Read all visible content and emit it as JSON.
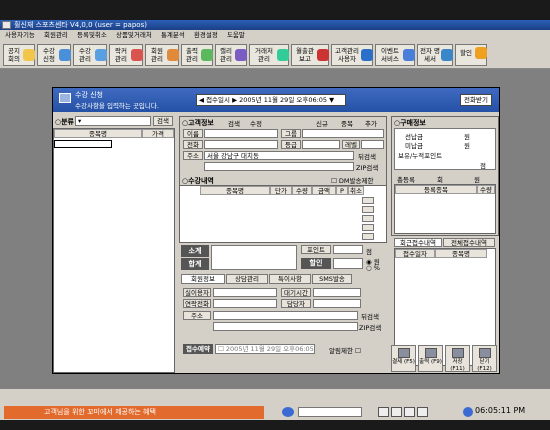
{
  "window": {
    "title": "휠신재 스포츠센타 V4,0,0 (user = papos)"
  },
  "menu": [
    "사용자기능",
    "회원관리",
    "등록및취소",
    "상품및거래처",
    "통계분석",
    "환경설정",
    "도움말"
  ],
  "toolbar": [
    {
      "label": "공지 회의",
      "icon": "note-icon",
      "color": "#f2c64a"
    },
    {
      "label": "수강 신청",
      "icon": "register-icon",
      "color": "#4a90d9"
    },
    {
      "label": "수강 관리",
      "icon": "manage-icon",
      "color": "#5aa0e0"
    },
    {
      "label": "락커 관리",
      "icon": "locker-icon",
      "color": "#d9534f"
    },
    {
      "label": "회원 관리",
      "icon": "members-icon",
      "color": "#e08a3c"
    },
    {
      "label": "출력 관리",
      "icon": "print-icon",
      "color": "#5cb85c"
    },
    {
      "label": "캘리 관리",
      "icon": "calendar-icon",
      "color": "#7a5cc2"
    },
    {
      "label": "거래처 관리",
      "icon": "partner-icon",
      "color": "#3c9"
    },
    {
      "label": "월출관 보고",
      "icon": "report-icon",
      "color": "#c33"
    },
    {
      "label": "고객관리 사용자",
      "icon": "question-icon",
      "color": "#2c6fc9"
    },
    {
      "label": "이벤트 서비스",
      "icon": "event-icon",
      "color": "#4a7fd9"
    },
    {
      "label": "전자 명세서",
      "icon": "globe-icon",
      "color": "#3a86c8"
    },
    {
      "label": "할인",
      "icon": "discount-icon",
      "color": "#f0a020"
    }
  ],
  "dialog": {
    "title": "수강 신청",
    "subtitle": "수강사항을 입력하는 곳입니다.",
    "date_label": "접수일시",
    "date_value": "2005년 11월 29일 오후06:05",
    "close_button": "전화받기",
    "left": {
      "section": "분류",
      "search_btn": "검색",
      "col_name": "종목명",
      "col_price": "가격"
    },
    "customer": {
      "section": "고객정보",
      "tab_search": "검색",
      "tab_edit": "수정",
      "btn_new": "신규",
      "btn_dup": "중복",
      "btn_add": "추가",
      "name_label": "이름",
      "group_label": "그룹",
      "phone_label": "전화",
      "grade_label": "등급",
      "level_label": "레벨",
      "addr_label": "주소",
      "addr_value": "서울 강남구 대치동",
      "addr_search": "뒤검색",
      "zip_search": "ZIP검색",
      "dm_label": "DM발송제한"
    },
    "enroll": {
      "section": "수강내역",
      "cols": [
        "종목명",
        "단가",
        "수량",
        "금액",
        "P",
        "취소"
      ],
      "subtotal": "소계",
      "total": "합계",
      "point_label": "포인트",
      "point_unit": "점",
      "discount_label": "할인",
      "won": "원",
      "percent": "%"
    },
    "tabs": [
      "회원정보",
      "상담관리",
      "특이사항",
      "SMS발송"
    ],
    "member": {
      "rel_label": "실이용자",
      "time_label": "대기시간",
      "contact_label": "연락전화",
      "manager_label": "담당자",
      "addr_label": "주소",
      "addr_search": "뒤검색",
      "zip_search": "ZIP검색",
      "receipt_label": "접수예약",
      "receipt_value": "2005년 11월 29일 오후06:05",
      "sms_label": "알림제한"
    },
    "purchase": {
      "section": "구매정보",
      "prepaid": "선납금",
      "unpaid": "미납금",
      "won": "원",
      "point_label": "보유/누적포인트",
      "point_unit": "점",
      "total_count": "총등록",
      "count_unit": "회",
      "count_label": "원",
      "col_item": "등록종목",
      "col_qty": "수량",
      "hist_tab1": "회근접수내역",
      "hist_tab2": "전체접수내역",
      "hist_col1": "접수일자",
      "hist_col2": "종목명"
    },
    "fbuttons": [
      {
        "label": "결제 (F5)"
      },
      {
        "label": "출력 (F9)"
      },
      {
        "label": "저장 (F11)"
      },
      {
        "label": "닫기 (F12)"
      }
    ]
  },
  "statusbar": {
    "promo": "고객님을 위한 꼬미에서 제공하는 혜택",
    "time": "06:05:11 PM"
  }
}
